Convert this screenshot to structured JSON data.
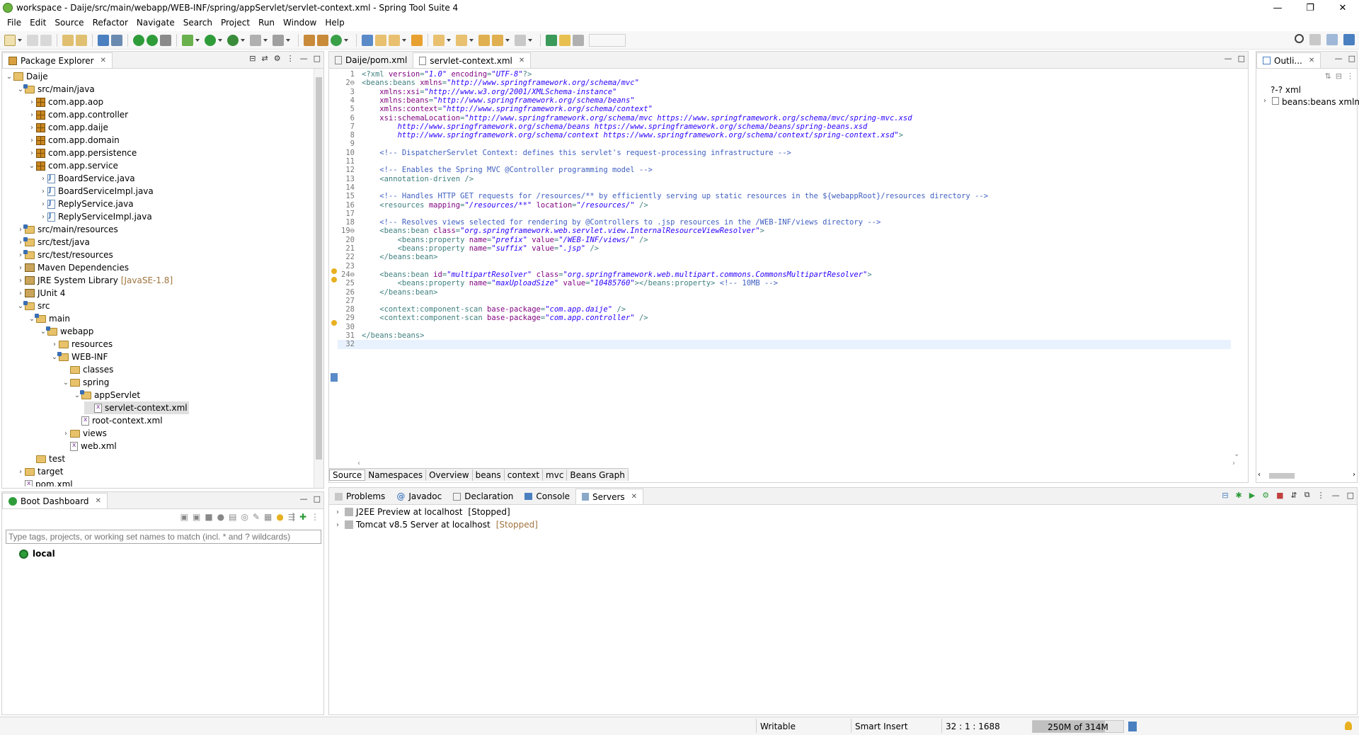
{
  "window": {
    "title": "workspace - Daije/src/main/webapp/WEB-INF/spring/appServlet/servlet-context.xml - Spring Tool Suite 4",
    "minimize": "—",
    "maximize": "❐",
    "close": "✕"
  },
  "menu": [
    "File",
    "Edit",
    "Source",
    "Refactor",
    "Navigate",
    "Search",
    "Project",
    "Run",
    "Window",
    "Help"
  ],
  "package_explorer": {
    "title": "Package Explorer",
    "tree": [
      {
        "label": "Daije",
        "indent": 0,
        "icon": "project",
        "chev": "⌄"
      },
      {
        "label": "src/main/java",
        "indent": 1,
        "icon": "srcfolder",
        "chev": "⌄"
      },
      {
        "label": "com.app.aop",
        "indent": 2,
        "icon": "package",
        "chev": "›"
      },
      {
        "label": "com.app.controller",
        "indent": 2,
        "icon": "package",
        "chev": "›"
      },
      {
        "label": "com.app.daije",
        "indent": 2,
        "icon": "package",
        "chev": "›"
      },
      {
        "label": "com.app.domain",
        "indent": 2,
        "icon": "package",
        "chev": "›"
      },
      {
        "label": "com.app.persistence",
        "indent": 2,
        "icon": "package",
        "chev": "›"
      },
      {
        "label": "com.app.service",
        "indent": 2,
        "icon": "package",
        "chev": "⌄"
      },
      {
        "label": "BoardService.java",
        "indent": 3,
        "icon": "java",
        "chev": "›"
      },
      {
        "label": "BoardServiceImpl.java",
        "indent": 3,
        "icon": "java",
        "chev": "›"
      },
      {
        "label": "ReplyService.java",
        "indent": 3,
        "icon": "java",
        "chev": "›"
      },
      {
        "label": "ReplyServiceImpl.java",
        "indent": 3,
        "icon": "java",
        "chev": "›"
      },
      {
        "label": "src/main/resources",
        "indent": 1,
        "icon": "srcfolder",
        "chev": "›"
      },
      {
        "label": "src/test/java",
        "indent": 1,
        "icon": "srcfolder",
        "chev": "›"
      },
      {
        "label": "src/test/resources",
        "indent": 1,
        "icon": "srcfolder",
        "chev": "›"
      },
      {
        "label": "Maven Dependencies",
        "indent": 1,
        "icon": "library",
        "chev": "›"
      },
      {
        "label": "JRE System Library",
        "indent": 1,
        "icon": "library",
        "chev": "›",
        "decor": "[JavaSE-1.8]"
      },
      {
        "label": "JUnit 4",
        "indent": 1,
        "icon": "library",
        "chev": "›"
      },
      {
        "label": "src",
        "indent": 1,
        "icon": "srcfolder",
        "chev": "⌄"
      },
      {
        "label": "main",
        "indent": 2,
        "icon": "srcfolder",
        "chev": "⌄"
      },
      {
        "label": "webapp",
        "indent": 3,
        "icon": "srcfolder",
        "chev": "⌄"
      },
      {
        "label": "resources",
        "indent": 4,
        "icon": "folder",
        "chev": "›"
      },
      {
        "label": "WEB-INF",
        "indent": 4,
        "icon": "srcfolder",
        "chev": "⌄"
      },
      {
        "label": "classes",
        "indent": 5,
        "icon": "folder",
        "chev": ""
      },
      {
        "label": "spring",
        "indent": 5,
        "icon": "folder",
        "chev": "⌄"
      },
      {
        "label": "appServlet",
        "indent": 6,
        "icon": "srcfolder",
        "chev": "⌄"
      },
      {
        "label": "servlet-context.xml",
        "indent": 7,
        "icon": "xml",
        "chev": "",
        "selected": true
      },
      {
        "label": "root-context.xml",
        "indent": 6,
        "icon": "xml",
        "chev": ""
      },
      {
        "label": "views",
        "indent": 5,
        "icon": "folder",
        "chev": "›"
      },
      {
        "label": "web.xml",
        "indent": 5,
        "icon": "xml",
        "chev": ""
      },
      {
        "label": "test",
        "indent": 2,
        "icon": "folder",
        "chev": ""
      },
      {
        "label": "target",
        "indent": 1,
        "icon": "folder",
        "chev": "›"
      },
      {
        "label": "pom.xml",
        "indent": 1,
        "icon": "xml",
        "chev": ""
      }
    ]
  },
  "boot_dashboard": {
    "title": "Boot Dashboard",
    "filter_placeholder": "Type tags, projects, or working set names to match (incl. * and ? wildcards)",
    "item": "local"
  },
  "editor": {
    "tabs": [
      {
        "label": "Daije/pom.xml",
        "active": false
      },
      {
        "label": "servlet-context.xml",
        "active": true
      }
    ],
    "lines": [
      {
        "n": "1",
        "parts": [
          [
            "pi",
            "<?xml "
          ],
          [
            "attr",
            "version"
          ],
          [
            "tag",
            "="
          ],
          [
            "str",
            "\"1.0\""
          ],
          [
            "tag",
            " "
          ],
          [
            "attr",
            "encoding"
          ],
          [
            "tag",
            "="
          ],
          [
            "str",
            "\"UTF-8\""
          ],
          [
            "pi",
            "?>"
          ]
        ]
      },
      {
        "n": "2⊖",
        "parts": [
          [
            "tag",
            "<beans:beans "
          ],
          [
            "attr",
            "xmlns"
          ],
          [
            "tag",
            "="
          ],
          [
            "str",
            "\"http://www.springframework.org/schema/mvc\""
          ]
        ]
      },
      {
        "n": "3",
        "parts": [
          [
            "tag",
            "    "
          ],
          [
            "attr",
            "xmlns:xsi"
          ],
          [
            "tag",
            "="
          ],
          [
            "str",
            "\"http://www.w3.org/2001/XMLSchema-instance\""
          ]
        ]
      },
      {
        "n": "4",
        "parts": [
          [
            "tag",
            "    "
          ],
          [
            "attr",
            "xmlns:beans"
          ],
          [
            "tag",
            "="
          ],
          [
            "str",
            "\"http://www.springframework.org/schema/beans\""
          ]
        ]
      },
      {
        "n": "5",
        "parts": [
          [
            "tag",
            "    "
          ],
          [
            "attr",
            "xmlns:context"
          ],
          [
            "tag",
            "="
          ],
          [
            "str",
            "\"http://www.springframework.org/schema/context\""
          ]
        ]
      },
      {
        "n": "6",
        "parts": [
          [
            "tag",
            "    "
          ],
          [
            "attr",
            "xsi:schemaLocation"
          ],
          [
            "tag",
            "="
          ],
          [
            "str",
            "\"http://www.springframework.org/schema/mvc https://www.springframework.org/schema/mvc/spring-mvc.xsd"
          ]
        ]
      },
      {
        "n": "7",
        "parts": [
          [
            "str",
            "        http://www.springframework.org/schema/beans https://www.springframework.org/schema/beans/spring-beans.xsd"
          ]
        ]
      },
      {
        "n": "8",
        "parts": [
          [
            "str",
            "        http://www.springframework.org/schema/context https://www.springframework.org/schema/context/spring-context.xsd\""
          ],
          [
            "tag",
            ">"
          ]
        ]
      },
      {
        "n": "9",
        "parts": []
      },
      {
        "n": "10",
        "parts": [
          [
            "com",
            "    <!-- DispatcherServlet Context: defines this servlet's request-processing infrastructure -->"
          ]
        ]
      },
      {
        "n": "11",
        "parts": []
      },
      {
        "n": "12",
        "parts": [
          [
            "com",
            "    <!-- Enables the Spring MVC @Controller programming model -->"
          ]
        ]
      },
      {
        "n": "13",
        "parts": [
          [
            "tag",
            "    <annotation-driven />"
          ]
        ]
      },
      {
        "n": "14",
        "parts": []
      },
      {
        "n": "15",
        "parts": [
          [
            "com",
            "    <!-- Handles HTTP GET requests for /resources/** by efficiently serving up static resources in the ${webappRoot}/resources directory -->"
          ]
        ]
      },
      {
        "n": "16",
        "parts": [
          [
            "tag",
            "    <resources "
          ],
          [
            "attr",
            "mapping"
          ],
          [
            "tag",
            "="
          ],
          [
            "str",
            "\"/resources/**\""
          ],
          [
            "tag",
            " "
          ],
          [
            "attr",
            "location"
          ],
          [
            "tag",
            "="
          ],
          [
            "str",
            "\"/resources/\""
          ],
          [
            "tag",
            " />"
          ]
        ]
      },
      {
        "n": "17",
        "parts": []
      },
      {
        "n": "18",
        "parts": [
          [
            "com",
            "    <!-- Resolves views selected for rendering by @Controllers to .jsp resources in the /WEB-INF/views directory -->"
          ]
        ]
      },
      {
        "n": "19⊖",
        "parts": [
          [
            "tag",
            "    <beans:bean "
          ],
          [
            "attr",
            "class"
          ],
          [
            "tag",
            "="
          ],
          [
            "str",
            "\"org.springframework.web.servlet.view.InternalResourceViewResolver\""
          ],
          [
            "tag",
            ">"
          ]
        ]
      },
      {
        "n": "20",
        "parts": [
          [
            "tag",
            "        <beans:property "
          ],
          [
            "attr",
            "name"
          ],
          [
            "tag",
            "="
          ],
          [
            "str",
            "\"prefix\""
          ],
          [
            "tag",
            " "
          ],
          [
            "attr",
            "value"
          ],
          [
            "tag",
            "="
          ],
          [
            "str",
            "\"/WEB-INF/views/\""
          ],
          [
            "tag",
            " />"
          ]
        ]
      },
      {
        "n": "21",
        "parts": [
          [
            "tag",
            "        <beans:property "
          ],
          [
            "attr",
            "name"
          ],
          [
            "tag",
            "="
          ],
          [
            "str",
            "\"suffix\""
          ],
          [
            "tag",
            " "
          ],
          [
            "attr",
            "value"
          ],
          [
            "tag",
            "="
          ],
          [
            "str",
            "\".jsp\""
          ],
          [
            "tag",
            " />"
          ]
        ]
      },
      {
        "n": "22",
        "parts": [
          [
            "tag",
            "    </beans:bean>"
          ]
        ]
      },
      {
        "n": "23",
        "parts": []
      },
      {
        "n": "24⊖",
        "parts": [
          [
            "tag",
            "    <beans:bean "
          ],
          [
            "attr",
            "id"
          ],
          [
            "tag",
            "="
          ],
          [
            "str",
            "\"multipartResolver\""
          ],
          [
            "tag",
            " "
          ],
          [
            "attr",
            "class"
          ],
          [
            "tag",
            "="
          ],
          [
            "str",
            "\"org.springframework.web.multipart.commons.CommonsMultipartResolver\""
          ],
          [
            "tag",
            ">"
          ]
        ]
      },
      {
        "n": "25",
        "parts": [
          [
            "tag",
            "        <beans:property "
          ],
          [
            "attr",
            "name"
          ],
          [
            "tag",
            "="
          ],
          [
            "str",
            "\"maxUploadSize\""
          ],
          [
            "tag",
            " "
          ],
          [
            "attr",
            "value"
          ],
          [
            "tag",
            "="
          ],
          [
            "str",
            "\"10485760\""
          ],
          [
            "tag",
            "></beans:property> "
          ],
          [
            "com",
            "<!-- 10MB -->"
          ]
        ]
      },
      {
        "n": "26",
        "parts": [
          [
            "tag",
            "    </beans:bean>"
          ]
        ]
      },
      {
        "n": "27",
        "parts": []
      },
      {
        "n": "28",
        "parts": [
          [
            "tag",
            "    <context:component-scan "
          ],
          [
            "attr",
            "base-package"
          ],
          [
            "tag",
            "="
          ],
          [
            "str",
            "\"com.app.daije\""
          ],
          [
            "tag",
            " />"
          ]
        ]
      },
      {
        "n": "29",
        "parts": [
          [
            "tag",
            "    <context:component-scan "
          ],
          [
            "attr",
            "base-package"
          ],
          [
            "tag",
            "="
          ],
          [
            "str",
            "\"com.app.controller\""
          ],
          [
            "tag",
            " />"
          ]
        ]
      },
      {
        "n": "30",
        "parts": []
      },
      {
        "n": "31",
        "parts": [
          [
            "tag",
            "</beans:beans>"
          ]
        ]
      },
      {
        "n": "32",
        "parts": []
      }
    ],
    "bottom_tabs": [
      "Source",
      "Namespaces",
      "Overview",
      "beans",
      "context",
      "mvc",
      "Beans Graph"
    ]
  },
  "outline": {
    "title": "Outli...",
    "items": [
      {
        "label": "?-? xml",
        "chev": ""
      },
      {
        "label": "beans:beans xmlns",
        "chev": "›"
      }
    ]
  },
  "bottom_panel": {
    "tabs": [
      {
        "label": "Problems",
        "active": false
      },
      {
        "label": "Javadoc",
        "active": false
      },
      {
        "label": "Declaration",
        "active": false
      },
      {
        "label": "Console",
        "active": false
      },
      {
        "label": "Servers",
        "active": true
      }
    ],
    "servers": [
      {
        "name": "J2EE Preview at localhost",
        "state": "[Stopped]"
      },
      {
        "name": "Tomcat v8.5 Server at localhost",
        "state": "[Stopped]"
      }
    ]
  },
  "status": {
    "writable": "Writable",
    "insert_mode": "Smart Insert",
    "position": "32 : 1 : 1688",
    "memory": "250M of 314M",
    "memory_fraction": 0.796
  }
}
